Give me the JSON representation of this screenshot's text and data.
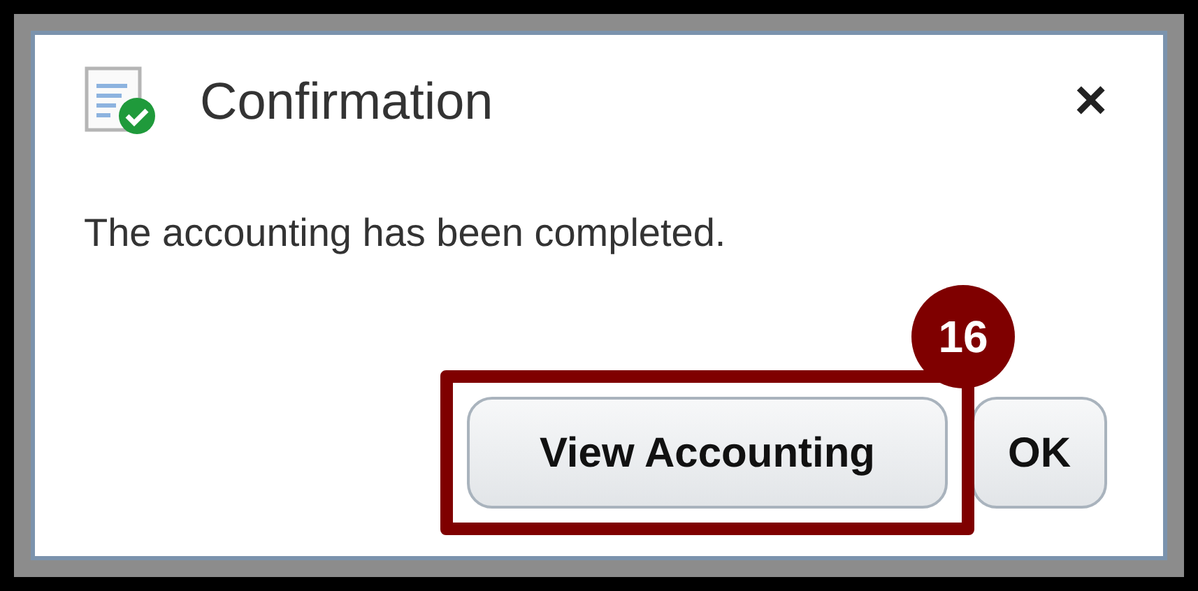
{
  "dialog": {
    "title": "Confirmation",
    "close": "×",
    "message": "The accounting has been completed.",
    "buttons": [
      {
        "label": "View Accounting",
        "highlighted": true
      },
      {
        "label": "OK",
        "highlighted": false
      }
    ]
  },
  "annotation": {
    "label": "16"
  }
}
